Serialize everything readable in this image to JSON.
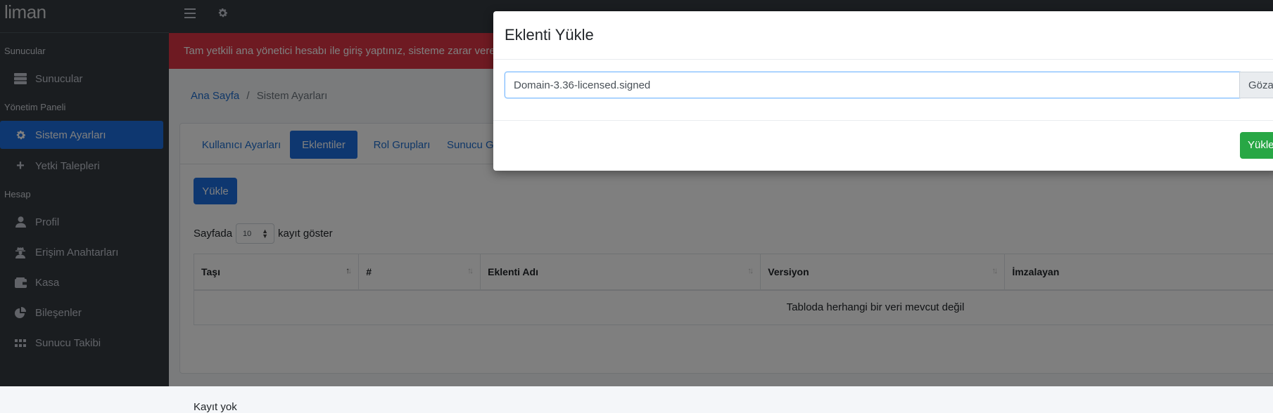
{
  "brand": "liman",
  "sidebar": {
    "headers": [
      "Sunucular",
      "Yönetim Paneli",
      "Hesap"
    ],
    "items": [
      {
        "label": "Sunucular",
        "icon": "server-icon"
      },
      {
        "label": "Sistem Ayarları",
        "icon": "gear-icon"
      },
      {
        "label": "Yetki Talepleri",
        "icon": "plus-icon"
      },
      {
        "label": "Profil",
        "icon": "user-icon"
      },
      {
        "label": "Erişim Anahtarları",
        "icon": "user-secret-icon"
      },
      {
        "label": "Kasa",
        "icon": "wallet-icon"
      },
      {
        "label": "Bileşenler",
        "icon": "pie-chart-icon"
      },
      {
        "label": "Sunucu Takibi",
        "icon": "grid-icon"
      }
    ],
    "active_item": "Sistem Ayarları"
  },
  "alert": {
    "text": "Tam yetkili ana yönetici hesabı ile giriş yaptınız, sisteme zarar vere"
  },
  "breadcrumb": {
    "home": "Ana Sayfa",
    "separator": "/",
    "current": "Sistem Ayarları"
  },
  "tabs": [
    "Kullanıcı Ayarları",
    "Eklentiler",
    "Rol Grupları",
    "Sunucu G"
  ],
  "active_tab": "Eklentiler",
  "upload_button": "Yükle",
  "length_menu": {
    "prefix": "Sayfada",
    "value": "10",
    "suffix": "kayıt göster"
  },
  "table": {
    "columns": [
      "Taşı",
      "#",
      "Eklenti Adı",
      "Versiyon",
      "İmzalayan"
    ],
    "empty_message": "Tabloda herhangi bir veri mevcut değil",
    "info": "Kayıt yok"
  },
  "modal": {
    "title": "Eklenti Yükle",
    "file_name": "Domain-3.36-licensed.signed",
    "browse_label": "Gözat",
    "submit_label": "Yükle"
  },
  "colors": {
    "primary": "#1d6fe0",
    "danger": "#dc3545",
    "success": "#28a745",
    "sidebar": "#343a40"
  }
}
